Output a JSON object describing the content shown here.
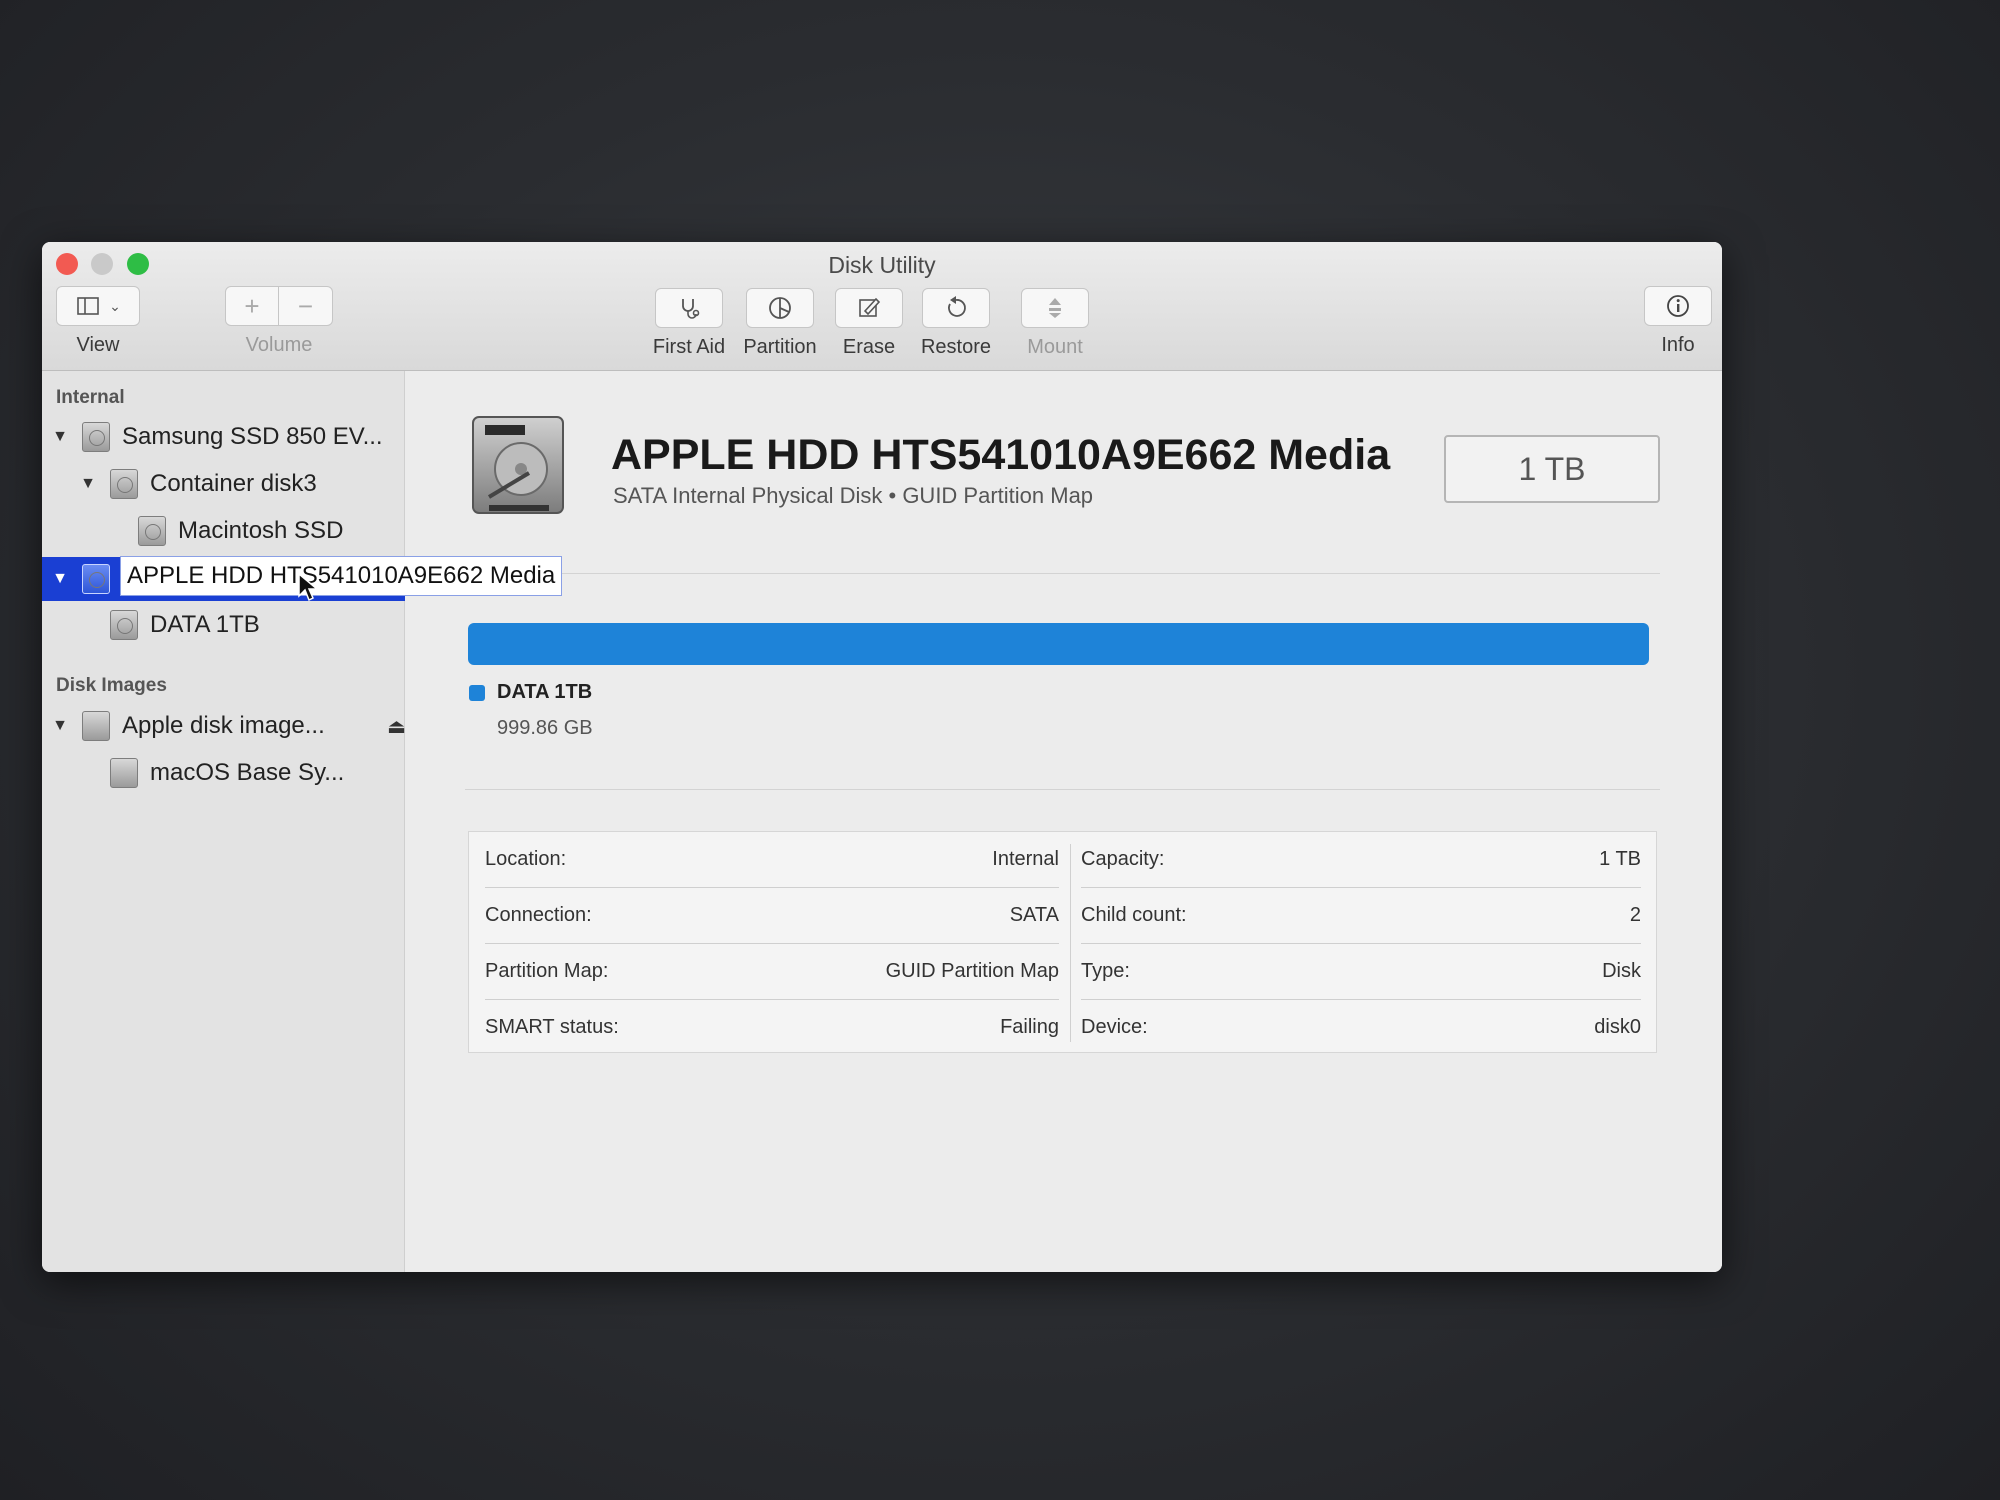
{
  "window": {
    "title": "Disk Utility"
  },
  "toolbar": {
    "view_label": "View",
    "volume_label": "Volume",
    "first_aid_label": "First Aid",
    "partition_label": "Partition",
    "erase_label": "Erase",
    "restore_label": "Restore",
    "mount_label": "Mount",
    "info_label": "Info"
  },
  "sidebar": {
    "internal_header": "Internal",
    "disk_images_header": "Disk Images",
    "items": [
      {
        "label": "Samsung SSD 850 EV..."
      },
      {
        "label": "Container disk3"
      },
      {
        "label": "Macintosh SSD"
      },
      {
        "label": "APPLE HDD HTS541010A9E662 Media",
        "selected": true,
        "renaming": true
      },
      {
        "label": "DATA 1TB"
      },
      {
        "label": "Apple disk image..."
      },
      {
        "label": "macOS Base Sy..."
      }
    ]
  },
  "main": {
    "disk_name": "APPLE HDD HTS541010A9E662 Media",
    "disk_subtitle": "SATA Internal Physical Disk • GUID Partition Map",
    "capacity_badge": "1 TB",
    "usage": {
      "volume_name": "DATA 1TB",
      "volume_size": "999.86 GB",
      "color": "#1e83d8"
    },
    "info_left": [
      {
        "key": "Location:",
        "value": "Internal"
      },
      {
        "key": "Connection:",
        "value": "SATA"
      },
      {
        "key": "Partition Map:",
        "value": "GUID Partition Map"
      },
      {
        "key": "SMART status:",
        "value": "Failing"
      }
    ],
    "info_right": [
      {
        "key": "Capacity:",
        "value": "1 TB"
      },
      {
        "key": "Child count:",
        "value": "2"
      },
      {
        "key": "Type:",
        "value": "Disk"
      },
      {
        "key": "Device:",
        "value": "disk0"
      }
    ]
  }
}
